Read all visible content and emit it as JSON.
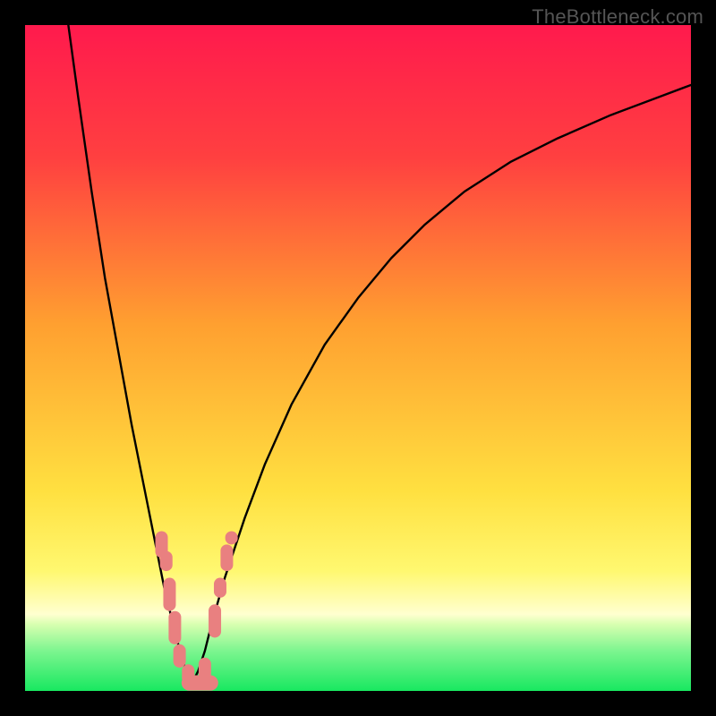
{
  "watermark": "TheBottleneck.com",
  "colors": {
    "frame": "#000000",
    "watermark": "#555555",
    "curve": "#000000",
    "marker": "#e98080"
  },
  "chart_data": {
    "type": "line",
    "title": "",
    "xlabel": "",
    "ylabel": "",
    "xlim": [
      0,
      100
    ],
    "ylim": [
      0,
      100
    ],
    "gradient_stops": [
      {
        "offset": 0.0,
        "color": "#ff1a4d"
      },
      {
        "offset": 0.2,
        "color": "#ff4040"
      },
      {
        "offset": 0.45,
        "color": "#ffa030"
      },
      {
        "offset": 0.7,
        "color": "#ffe040"
      },
      {
        "offset": 0.82,
        "color": "#fff870"
      },
      {
        "offset": 0.885,
        "color": "#ffffd0"
      },
      {
        "offset": 0.9,
        "color": "#d8ffb0"
      },
      {
        "offset": 0.94,
        "color": "#7cf58f"
      },
      {
        "offset": 1.0,
        "color": "#18e860"
      }
    ],
    "series": [
      {
        "name": "left-branch",
        "x": [
          6.5,
          8,
          10,
          12,
          14,
          16,
          17,
          18,
          19,
          20,
          21,
          22,
          23,
          24,
          25
        ],
        "y": [
          100,
          89,
          75,
          62,
          51,
          40,
          35,
          30,
          25,
          20,
          15,
          11,
          7,
          3.5,
          1
        ]
      },
      {
        "name": "right-branch",
        "x": [
          25,
          26,
          27,
          28,
          30,
          33,
          36,
          40,
          45,
          50,
          55,
          60,
          66,
          73,
          80,
          88,
          96,
          100
        ],
        "y": [
          1,
          3,
          6,
          10,
          17,
          26,
          34,
          43,
          52,
          59,
          65,
          70,
          75,
          79.5,
          83,
          86.5,
          89.5,
          91
        ]
      }
    ],
    "markers": {
      "name": "highlight-segments",
      "shape": "rounded-rect",
      "color": "#e98080",
      "points": [
        {
          "x": 20.5,
          "y1": 20,
          "y2": 24
        },
        {
          "x": 21.2,
          "y1": 18,
          "y2": 21
        },
        {
          "x": 21.7,
          "y1": 12,
          "y2": 17
        },
        {
          "x": 22.5,
          "y1": 7,
          "y2": 12
        },
        {
          "x": 23.2,
          "y1": 3.5,
          "y2": 7
        },
        {
          "x": 24.5,
          "y1": 1,
          "y2": 4
        },
        {
          "x": 27.0,
          "y1": 1,
          "y2": 5
        },
        {
          "x": 28.5,
          "y1": 8,
          "y2": 13
        },
        {
          "x": 29.3,
          "y1": 14,
          "y2": 17
        },
        {
          "x": 30.3,
          "y1": 18,
          "y2": 22
        },
        {
          "x": 31.0,
          "y1": 22,
          "y2": 24
        }
      ],
      "bottom_bar": {
        "x1": 23.5,
        "x2": 29.0,
        "y": 1.2,
        "h": 2.3
      }
    }
  }
}
